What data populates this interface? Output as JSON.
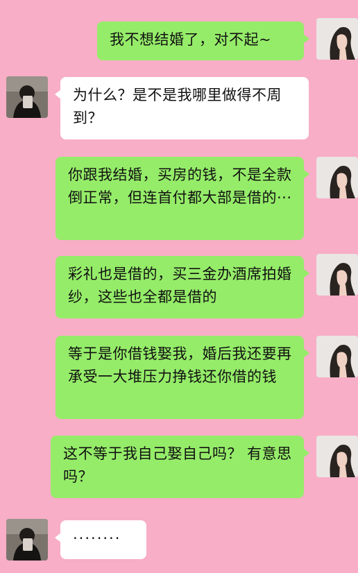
{
  "messages": [
    {
      "side": "right",
      "text": "我不想结婚了，对不起~"
    },
    {
      "side": "left",
      "text": "为什么？是不是我哪里做得不周到？"
    },
    {
      "side": "right",
      "text": "你跟我结婚，买房的钱，不是全款倒正常，但连首付都大部是借的···"
    },
    {
      "side": "right",
      "text": "彩礼也是借的，买三金办酒席拍婚纱，这些也全都是借的"
    },
    {
      "side": "right",
      "text": "等于是你借钱娶我，婚后我还要再承受一大堆压力挣钱还你借的钱"
    },
    {
      "side": "right",
      "text": "这不等于我自己娶自己吗？ 有意思吗？"
    },
    {
      "side": "left",
      "text": "········"
    }
  ],
  "avatars": {
    "self": "woman-profile-avatar",
    "other": "man-mirror-selfie-avatar"
  },
  "colors": {
    "background": "#f7aec6",
    "bubble_self": "#95ec69",
    "bubble_other": "#ffffff"
  }
}
